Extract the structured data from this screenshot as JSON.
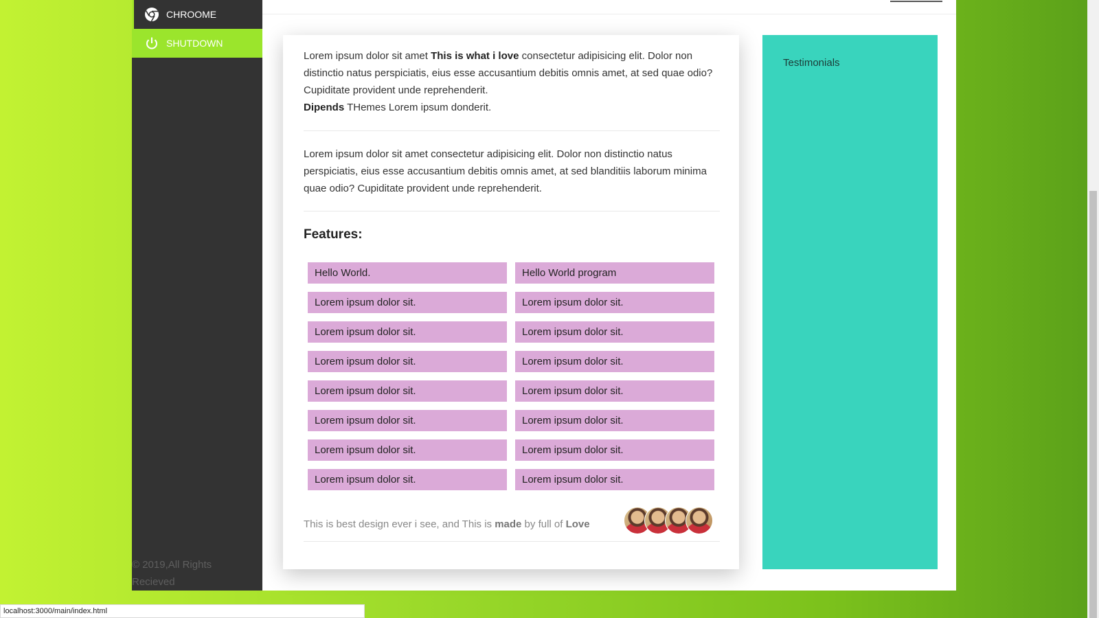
{
  "sidebar": {
    "items": [
      {
        "label": "CHROOME",
        "icon": "chrome-icon"
      },
      {
        "label": "SHUTDOWN",
        "icon": "power-icon"
      }
    ],
    "copyright": "© 2019,All Rights Recieved"
  },
  "main": {
    "para1": {
      "t1": "Lorem ipsum dolor sit amet ",
      "b1": "This is what i love",
      "t2": " consectetur adipisicing elit. Dolor non distinctio natus perspiciatis, eius esse accusantium debitis omnis amet, at sed quae odio? Cupiditate provident unde reprehenderit.",
      "b2": "Dipends",
      "t3": " THemes Lorem ipsum donderit."
    },
    "para2": "Lorem ipsum dolor sit amet consectetur adipisicing elit. Dolor non distinctio natus perspiciatis, eius esse accusantium debitis omnis amet, at sed blanditiis laborum minima quae odio? Cupiditate provident unde reprehenderit.",
    "features_title": "Features:",
    "features": [
      "Hello World.",
      "Hello World program",
      "Lorem ipsum dolor sit.",
      "Lorem ipsum dolor sit.",
      "Lorem ipsum dolor sit.",
      "Lorem ipsum dolor sit.",
      "Lorem ipsum dolor sit.",
      "Lorem ipsum dolor sit.",
      "Lorem ipsum dolor sit.",
      "Lorem ipsum dolor sit.",
      "Lorem ipsum dolor sit.",
      "Lorem ipsum dolor sit.",
      "Lorem ipsum dolor sit.",
      "Lorem ipsum dolor sit.",
      "Lorem ipsum dolor sit.",
      "Lorem ipsum dolor sit."
    ],
    "footer": {
      "t1": "This is best design ever i see, and This is ",
      "b1": "made",
      "t2": " by full of ",
      "b2": "Love"
    }
  },
  "testimonials": {
    "title": "Testimonials"
  },
  "status_url": "localhost:3000/main/index.html",
  "colors": {
    "accent_green": "#9be52c",
    "sidebar_bg": "#333333",
    "feature_tag": "#dbaad8",
    "testimonials_bg": "#39d4bd"
  }
}
